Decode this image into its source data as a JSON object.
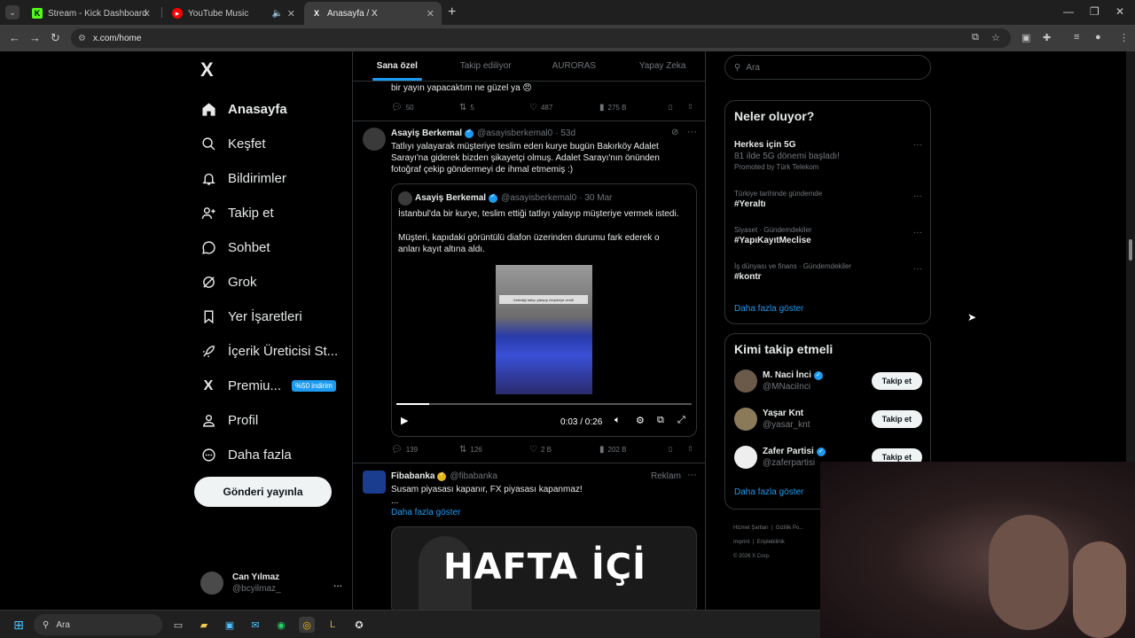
{
  "browser": {
    "tabs": [
      {
        "title": "Stream - Kick Dashboard",
        "favicon": "K"
      },
      {
        "title": "YouTube Music"
      },
      {
        "title": "Anasayfa / X",
        "favicon": "X"
      }
    ],
    "url": "x.com/home",
    "new_tab": "+"
  },
  "sidebar": {
    "logo": "X",
    "items": [
      {
        "label": "Anasayfa",
        "icon": "home-icon"
      },
      {
        "label": "Keşfet",
        "icon": "search-icon"
      },
      {
        "label": "Bildirimler",
        "icon": "bell-icon"
      },
      {
        "label": "Takip et",
        "icon": "follow-icon"
      },
      {
        "label": "Sohbet",
        "icon": "chat-icon"
      },
      {
        "label": "Grok",
        "icon": "grok-icon"
      },
      {
        "label": "Yer İşaretleri",
        "icon": "bookmark-icon"
      },
      {
        "label": "İçerik Üreticisi St...",
        "icon": "rocket-icon"
      },
      {
        "label": "Premiu...",
        "icon": "x-premium-icon",
        "badge": "%50 indirim"
      },
      {
        "label": "Profil",
        "icon": "person-icon"
      },
      {
        "label": "Daha fazla",
        "icon": "more-circle-icon"
      }
    ],
    "post_button": "Gönderi yayınla",
    "account": {
      "name": "Can Yılmaz",
      "handle": "@bcyilmaz_",
      "more": "..."
    }
  },
  "feed": {
    "tabs": [
      "Sana özel",
      "Takip ediliyor",
      "AURORAS",
      "Yapay Zeka"
    ],
    "prev_tweet": {
      "text": "bir yayın yapacaktım ne güzel ya 😠",
      "replies": "50",
      "reposts": "5",
      "likes": "487",
      "views": "275 B"
    },
    "tweet": {
      "name": "Asayiş Berkemal",
      "handle": "@asayisberkemal0",
      "time": "· 53d",
      "text": "Tatlıyı yalayarak müşteriye teslim eden kurye bugün Bakırköy Adalet Sarayı'na giderek bizden şikayetçi olmuş. Adalet Sarayı'nın önünden fotoğraf çekip göndermeyi de ihmal etmemiş :)",
      "quote": {
        "name": "Asayiş Berkemal",
        "handle": "@asayisberkemal0",
        "time": "· 30 Mar",
        "text1": "İstanbul'da bir kurye, teslim ettiği tatlıyı yalayıp müşteriye vermek istedi.",
        "text2": "Müşteri, kapıdaki görüntülü diafon üzerinden durumu fark ederek o anları kayıt altına aldı.",
        "video_caption": "Getirdiği tatlıyı yalayıp müşteriye verdi!",
        "video_time": "0:03 / 0:26",
        "progress": 0.11
      },
      "replies": "139",
      "reposts": "126",
      "likes": "2 B",
      "views": "202 B"
    },
    "ad": {
      "name": "Fibabanka",
      "handle": "@fibabanka",
      "label": "Reklam",
      "text": "Susam piyasası kapanır, FX piyasası kapanmaz!",
      "ellipsis": "...",
      "show_more": "Daha fazla göster",
      "image_text": "HAFTA İÇİ"
    }
  },
  "right": {
    "search_placeholder": "Ara",
    "trends_title": "Neler oluyor?",
    "trends": [
      {
        "title": "Herkes için 5G",
        "sub": "81 ilde 5G dönemi başladı!",
        "promoted": "Promoted by Türk Telekom"
      },
      {
        "context": "Türkiye tarihinde gündemde",
        "title": "#Yeraltı"
      },
      {
        "context": "Siyaset · Gündemdekiler",
        "title": "#YapıKayıtMeclise"
      },
      {
        "context": "İş dünyası ve finans · Gündemdekiler",
        "title": "#kontr"
      }
    ],
    "trends_more": "Daha fazla göster",
    "who_title": "Kimi takip etmeli",
    "who": [
      {
        "name": "M. Naci İnci",
        "handle": "@MNaciInci",
        "verified": true,
        "button": "Takip et"
      },
      {
        "name": "Yaşar Knt",
        "handle": "@yasar_knt",
        "verified": false,
        "button": "Takip et"
      },
      {
        "name": "Zafer Partisi",
        "handle": "@zaferpartisi",
        "verified": true,
        "button": "Takip et"
      }
    ],
    "who_more": "Daha fazla göster",
    "footer": [
      "Hizmet Şartları",
      "Gizlilik Po...",
      "Imprint",
      "Erişilebilirlik",
      "© 2026 X Corp."
    ]
  },
  "taskbar": {
    "search": "Ara"
  },
  "colors": {
    "accent": "#1d9bf0",
    "bg": "#000000",
    "border": "#2f3336",
    "muted": "#71767b"
  }
}
